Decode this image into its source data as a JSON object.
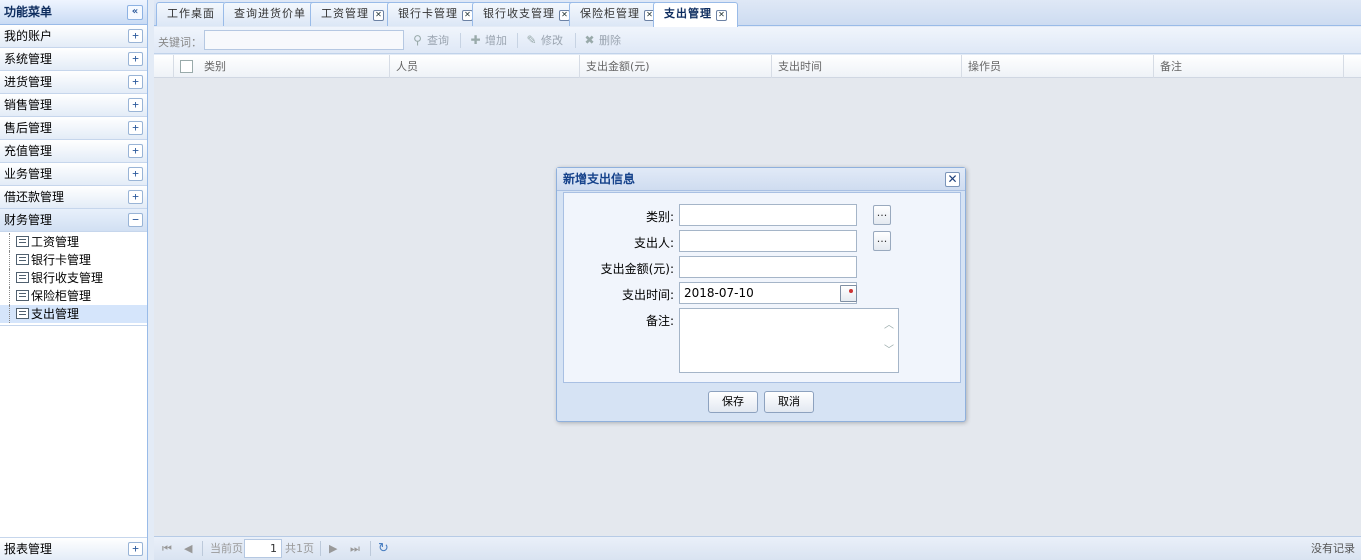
{
  "sidebar": {
    "title": "功能菜单",
    "collapse_glyph": "«",
    "panels": [
      {
        "label": "我的账户",
        "toggle": "+"
      },
      {
        "label": "系统管理",
        "toggle": "+"
      },
      {
        "label": "进货管理",
        "toggle": "+"
      },
      {
        "label": "销售管理",
        "toggle": "+"
      },
      {
        "label": "售后管理",
        "toggle": "+"
      },
      {
        "label": "充值管理",
        "toggle": "+"
      },
      {
        "label": "业务管理",
        "toggle": "+"
      },
      {
        "label": "借还款管理",
        "toggle": "+"
      },
      {
        "label": "财务管理",
        "toggle": "−"
      }
    ],
    "finance_items": [
      "工资管理",
      "银行卡管理",
      "银行收支管理",
      "保险柜管理",
      "支出管理"
    ],
    "bottom_panel": {
      "label": "报表管理",
      "toggle": "+"
    }
  },
  "tabs": [
    {
      "label": "工作桌面",
      "closable": false
    },
    {
      "label": "查询进货价单",
      "closable": false
    },
    {
      "label": "工资管理",
      "closable": true
    },
    {
      "label": "银行卡管理",
      "closable": true
    },
    {
      "label": "银行收支管理",
      "closable": true
    },
    {
      "label": "保险柜管理",
      "closable": true
    },
    {
      "label": "支出管理",
      "closable": true,
      "active": true
    }
  ],
  "toolbar": {
    "keyword_label": "关键词：",
    "search_label": "查询",
    "add_label": "增加",
    "edit_label": "修改",
    "delete_label": "删除"
  },
  "grid": {
    "columns": [
      "类别",
      "人员",
      "支出金额(元)",
      "支出时间",
      "操作员",
      "备注"
    ]
  },
  "pager": {
    "current_page_label": "当前页",
    "page_value": "1",
    "total_pages_label": "共1页",
    "no_records": "没有记录"
  },
  "dialog": {
    "title": "新增支出信息",
    "close_glyph": "✕",
    "fields": {
      "category_label": "类别:",
      "payer_label": "支出人:",
      "amount_label": "支出金额(元):",
      "time_label": "支出时间:",
      "time_value": "2018-07-10",
      "note_label": "备注:"
    },
    "pick_glyph": "...",
    "save_label": "保存",
    "cancel_label": "取消"
  },
  "colors": {
    "accent": "#15428b",
    "border": "#99bbe8",
    "grid_bg": "#e4e8ee"
  }
}
